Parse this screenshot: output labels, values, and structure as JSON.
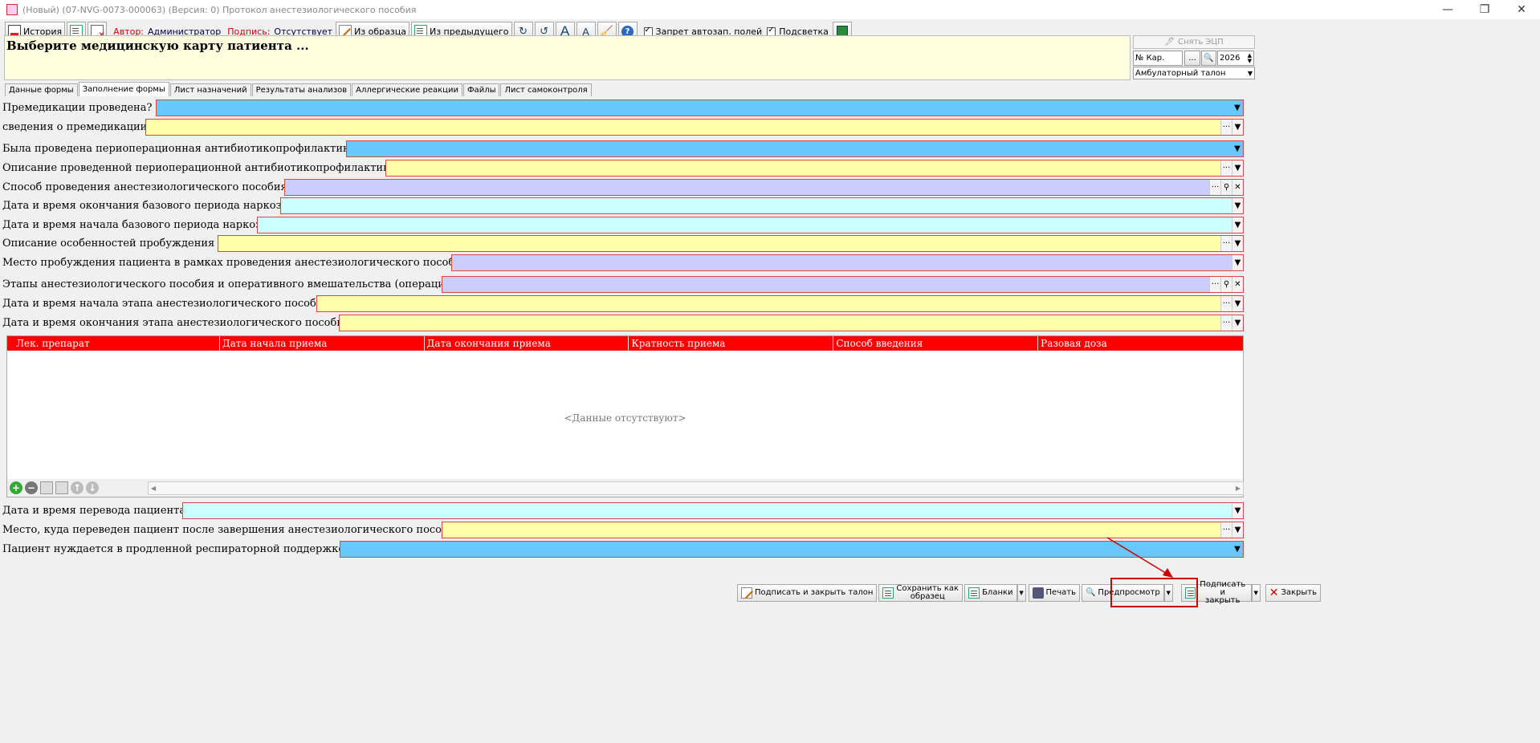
{
  "window": {
    "title": "(Новый) (07-NVG-0073-000063) (Версия: 0) Протокол анестезиологического пособия"
  },
  "toolbar": {
    "history": "История",
    "author_label": "Автор:",
    "author_value": "Администратор",
    "sign_label": "Подпись:",
    "sign_value": "Отсутствует",
    "from_sample": "Из образца",
    "from_previous": "Из предыдущего",
    "no_autofill": "Запрет автозап. полей",
    "highlight": "Подсветка",
    "font_up": "A",
    "font_down": "A",
    "help": "?"
  },
  "header": {
    "prompt": "Выберите медицинскую карту патиента ..."
  },
  "right_panel": {
    "remove_ecp": "Снять ЭЦП",
    "card_no_placeholder": "№ Кар.",
    "dots": "...",
    "year": "2026",
    "doc_type": "Амбулаторный талон"
  },
  "tabs": [
    "Данные формы",
    "Заполнение формы",
    "Лист назначений",
    "Результаты анализов",
    "Аллергические реакции",
    "Файлы",
    "Лист самоконтроля"
  ],
  "fields": [
    {
      "label": "Премедикации проведена?"
    },
    {
      "label": "сведения о премедикации"
    },
    {
      "label": "Была проведена периоперационная антибиотикопрофилактика?"
    },
    {
      "label": "Описание проведенной периоперационной антибиотикопрофилактики"
    },
    {
      "label": "Способ проведения анестезиологического пособия"
    },
    {
      "label": "Дата и время окончания базового периода наркоза"
    },
    {
      "label": "Дата и время начала базового периода наркоза"
    },
    {
      "label": "Описание особенностей пробуждения "
    },
    {
      "label": "Место пробуждения пациента в рамках проведения анестезиологического пособия"
    },
    {
      "label": "Этапы анестезиологического пособия и оперативного вмешательства (операции)"
    },
    {
      "label": "Дата и время начала этапа анестезиологического пособия"
    },
    {
      "label": "Дата и время окончания этапа анестезиологического пособия"
    },
    {
      "label": "Дата и время перевода пациента"
    },
    {
      "label": "Место, куда переведен пациент после завершения анестезиологического пособия"
    },
    {
      "label": "Пациент нуждается в продленной респираторной поддержке?"
    }
  ],
  "grid": {
    "columns": [
      "Лек. препарат",
      "Дата начала приема",
      "Дата окончания приема",
      "Кратность приема",
      "Способ введения",
      "Разовая доза"
    ],
    "empty_text": "<Данные отсутствуют>"
  },
  "buttons": {
    "sign_close_ticket": "Подписать и закрыть талон",
    "save_as_sample_1": "Сохранить как",
    "save_as_sample_2": "образец",
    "blanks": "Бланки",
    "print": "Печать",
    "preview": "Предпросмотр",
    "sign_close_1": "Подписать и",
    "sign_close_2": "закрыть",
    "close": "Закрыть"
  },
  "colors": {
    "required_blue": "#66c8ff",
    "text_yellow": "#ffffaa",
    "ref_lilac": "#ccccff",
    "date_cyan": "#ccffff",
    "grid_header": "#ff0000"
  }
}
